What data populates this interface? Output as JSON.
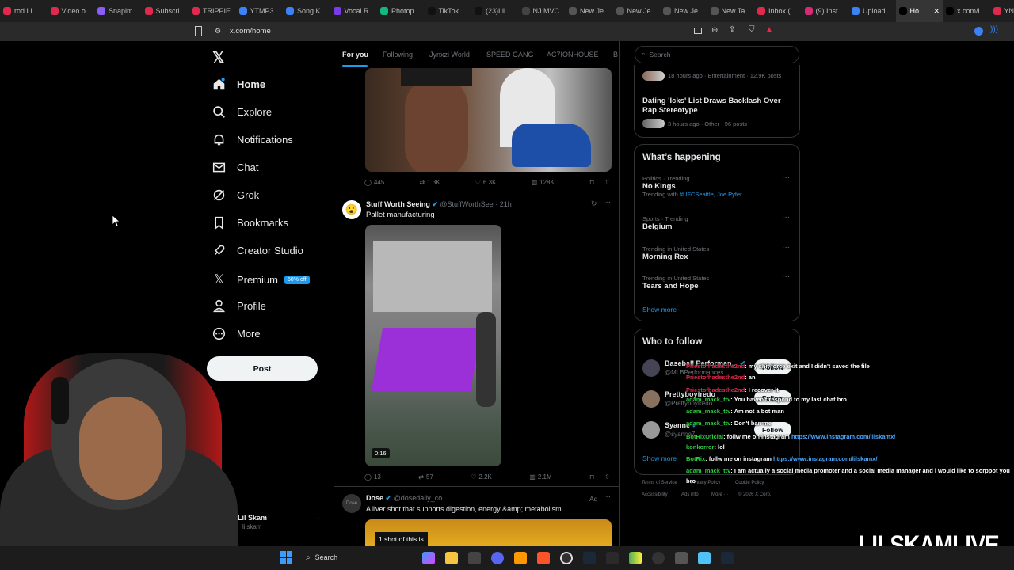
{
  "browser": {
    "tabs": [
      {
        "label": "rod Li",
        "color": "#e0294e"
      },
      {
        "label": "Video o",
        "color": "#e0294e"
      },
      {
        "label": "Snaplm",
        "color": "#8b5cf6"
      },
      {
        "label": "Subscri",
        "color": "#e0294e"
      },
      {
        "label": "TRIPPIE",
        "color": "#e0294e"
      },
      {
        "label": "YTMP3",
        "color": "#3b82f6"
      },
      {
        "label": "Song K",
        "color": "#3b82f6"
      },
      {
        "label": "Vocal R",
        "color": "#7c3aed"
      },
      {
        "label": "Photop",
        "color": "#10b981"
      },
      {
        "label": "TikTok",
        "color": "#111"
      },
      {
        "label": "(23)Lil",
        "color": "#111"
      },
      {
        "label": "NJ MVC",
        "color": "#444"
      },
      {
        "label": "New Je",
        "color": "#555"
      },
      {
        "label": "New Je",
        "color": "#555"
      },
      {
        "label": "New Je",
        "color": "#555"
      },
      {
        "label": "New Ta",
        "color": "#555"
      },
      {
        "label": "Inbox (",
        "color": "#e0294e"
      },
      {
        "label": "(9) Inst",
        "color": "#d62976"
      },
      {
        "label": "Upload",
        "color": "#3b82f6"
      },
      {
        "label": "Ho",
        "color": "#000",
        "active": true
      },
      {
        "label": "x.com/i",
        "color": "#000"
      },
      {
        "label": "YNW",
        "color": "#e0294e"
      }
    ],
    "url": "x.com/home"
  },
  "nav": {
    "items": [
      "Home",
      "Explore",
      "Notifications",
      "Chat",
      "Grok",
      "Bookmarks",
      "Creator Studio",
      "Premium",
      "Profile",
      "More"
    ],
    "premium_badge": "50% off",
    "post_label": "Post",
    "account_name": "Lil Skam",
    "account_handle": "lilskam"
  },
  "timeline": {
    "tabs": [
      "For you",
      "Following",
      "Jynxzi World",
      "SPEED GANG",
      "AC7IONHOUSE",
      "B"
    ],
    "post1_stats": {
      "replies": "445",
      "reposts": "1.3K",
      "likes": "6.3K",
      "views": "128K"
    },
    "post2": {
      "author": "Stuff Worth Seeing",
      "handle": "@StuffWorthSee · 21h",
      "text": "Pallet manufacturing",
      "duration": "0:16",
      "replies": "13",
      "reposts": "57",
      "likes": "2.2K",
      "views": "2.1M"
    },
    "post3": {
      "author": "Dose",
      "handle": "@dosedaily_co",
      "ad": "Ad",
      "text": "A liver shot that supports digestion, energy &amp; metabolism",
      "image_caption": "1 shot of this is",
      "avatar_text": "Dose"
    }
  },
  "sidebar": {
    "search_placeholder": "Search",
    "news1_meta": "18 hours ago · Entertainment · 12.9K posts",
    "news2_title": "Dating 'Icks' List Draws Backlash Over Rap Stereotype",
    "news2_meta": "3 hours ago · Other · 96 posts",
    "happening_title": "What’s happening",
    "trends": [
      {
        "cat": "Politics · Trending",
        "name": "No Kings",
        "sub": "Trending with",
        "tags": "#UFCSeattle, Joe Pyfer"
      },
      {
        "cat": "Sports · Trending",
        "name": "Belgium"
      },
      {
        "cat": "Trending in United States",
        "name": "Morning Rex"
      },
      {
        "cat": "Trending in United States",
        "name": "Tears and Hope"
      }
    ],
    "show_more": "Show more",
    "who_title": "Who to follow",
    "follow": [
      {
        "name": "Baseball Performan...",
        "handle": "@MLBPerformances"
      },
      {
        "name": "Prettyboyfredo",
        "handle": "@Prettyboyfredo"
      },
      {
        "name": "Syanne",
        "handle": "@syanne7"
      }
    ],
    "follow_label": "Follow",
    "footer1": "Terms of Service",
    "footer2": "Accessibility",
    "footer_privacy": "Privacy Policy",
    "footer_cookie": "Cookie Policy",
    "footer_ads": "Ads info",
    "footer_more": "More ···",
    "footer_copy": "© 2026 X Corp."
  },
  "chat": [
    {
      "user": "Priestofhadesthe2nd",
      "msg": ": my shit force exit and I didn't saved the file",
      "cls": "r"
    },
    {
      "user": "Priestofhadesthe2nd",
      "msg": ": an",
      "cls": "r"
    },
    {
      "user": "Priestofhadesthe2nd",
      "msg": ": I recover it",
      "cls": "r"
    },
    {
      "user": "adam_mack_ttv",
      "msg": ": You haven't respond to my last chat bro",
      "cls": "g"
    },
    {
      "user": "adam_mack_ttv",
      "msg": ": Am not a bot man",
      "cls": "g"
    },
    {
      "user": "adam_mack_ttv",
      "msg": ": Don't ban me",
      "cls": "g"
    },
    {
      "user": "BotRixOficial",
      "msg": ": follw me on instagram ",
      "link": "https://www.instagram.com/lilskamx/",
      "cls": "g"
    },
    {
      "user": "konkorror",
      "msg": ": lol",
      "cls": "g"
    },
    {
      "user": "BotRix",
      "msg": ": follw me on instagram ",
      "link": "https://www.instagram.com/lilskamx/",
      "cls": "g"
    },
    {
      "user": "adam_mack_ttv",
      "msg": ": I am actually a social media promoter and a social media manager and i would like to sorppot you",
      "cls": "g"
    },
    {
      "user": "",
      "msg": "bro",
      "cls": "g"
    }
  ],
  "overlay": {
    "channel": "LILSKAMLIVE"
  },
  "taskbar": {
    "search": "Search"
  }
}
